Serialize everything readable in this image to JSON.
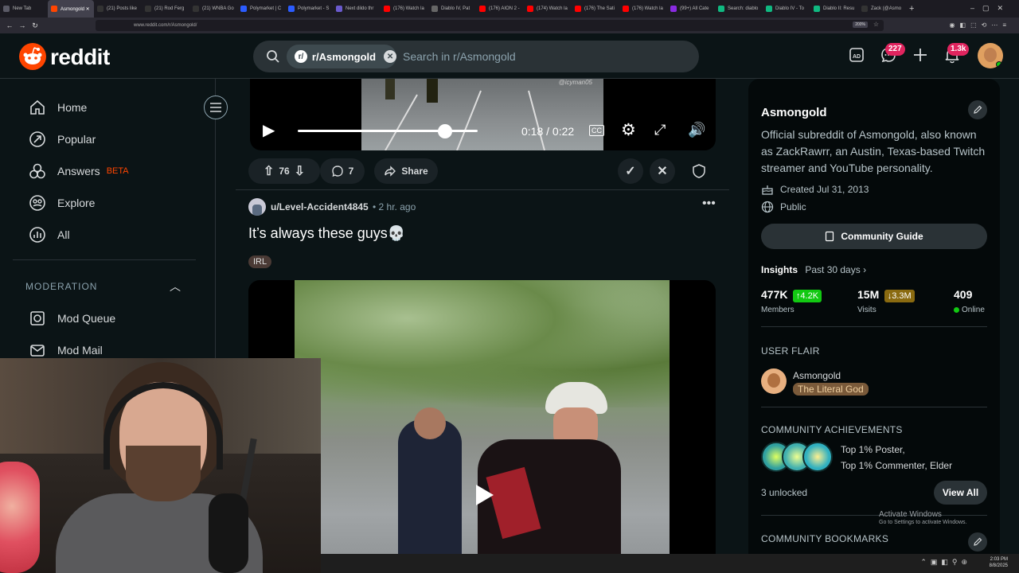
{
  "browser": {
    "tabs": [
      {
        "label": "New Tab",
        "color": "#5a5a66"
      },
      {
        "label": "Asmongold ✕",
        "color": "#ff4500"
      },
      {
        "label": "(21) Posts like",
        "color": "#333"
      },
      {
        "label": "(21) Rod Ferg",
        "color": "#333"
      },
      {
        "label": "(21) WNBA Go",
        "color": "#333"
      },
      {
        "label": "Polymarket | C",
        "color": "#2b5cff"
      },
      {
        "label": "Polymarket - S",
        "color": "#2b5cff"
      },
      {
        "label": "Next dildo thr",
        "color": "#6a5acd"
      },
      {
        "label": "(176) Watch la",
        "color": "#ff0000"
      },
      {
        "label": "Diablo IV, Pat",
        "color": "#666"
      },
      {
        "label": "(176) AION 2 -",
        "color": "#ff0000"
      },
      {
        "label": "(174) Watch la",
        "color": "#ff0000"
      },
      {
        "label": "(176) The Sati",
        "color": "#ff0000"
      },
      {
        "label": "(176) Watch la",
        "color": "#ff0000"
      },
      {
        "label": "(99+) All Cate",
        "color": "#8a2be2"
      },
      {
        "label": "Search: diablo",
        "color": "#10b981"
      },
      {
        "label": "Diablo IV - To",
        "color": "#10b981"
      },
      {
        "label": "Diablo II: Resu",
        "color": "#10b981"
      },
      {
        "label": "Zack (@Asmo",
        "color": "#333"
      }
    ],
    "url": "www.reddit.com/r/Asmongold/",
    "zoom": "200%"
  },
  "header": {
    "logo_text": "reddit",
    "search_chip": "r/Asmongold",
    "search_placeholder": "Search in r/Asmongold",
    "chat_badge": "227",
    "notif_badge": "1.3k"
  },
  "sidebar": {
    "items": [
      {
        "label": "Home"
      },
      {
        "label": "Popular"
      },
      {
        "label": "Answers",
        "tag": "BETA"
      },
      {
        "label": "Explore"
      },
      {
        "label": "All"
      }
    ],
    "moderation_heading": "MODERATION",
    "mod_items": [
      {
        "label": "Mod Queue"
      },
      {
        "label": "Mod Mail"
      }
    ]
  },
  "video_player": {
    "time": "0:18 / 0:22",
    "watermark": "@icyman05",
    "progress": 0.82
  },
  "post_actions": {
    "votes": "76",
    "comments": "7",
    "share": "Share"
  },
  "post": {
    "author": "u/Level-Accident4845",
    "time": "• 2 hr. ago",
    "title": "It’s always these guys💀",
    "flair": "IRL"
  },
  "community": {
    "name": "Asmongold",
    "description": "Official subreddit of Asmongold, also known as ZackRawrr, an Austin, Texas-based Twitch streamer and YouTube personality.",
    "created": "Created Jul 31, 2013",
    "visibility": "Public",
    "guide_button": "Community Guide",
    "insights_label": "Insights",
    "insights_period": "Past 30 days",
    "stats": [
      {
        "value": "477K",
        "delta": "↑4.2K",
        "label": "Members",
        "delta_color": "#12c912"
      },
      {
        "value": "15M",
        "delta": "↓3.3M",
        "label": "Visits",
        "delta_color": "#b8860b"
      },
      {
        "value": "409",
        "delta": "",
        "label": "Online",
        "delta_color": ""
      }
    ],
    "user_flair_heading": "USER FLAIR",
    "flair_user": "Asmongold",
    "flair_text": "The Literal God",
    "achievements_heading": "COMMUNITY ACHIEVEMENTS",
    "achievements_line1": "Top 1% Poster,",
    "achievements_line2": "Top 1% Commenter, Elder",
    "unlocked": "3 unlocked",
    "view_all": "View All",
    "bookmarks_heading": "COMMUNITY BOOKMARKS"
  },
  "windows_watermark": {
    "line1": "Activate Windows",
    "line2": "Go to Settings to activate Windows."
  },
  "taskbar": {
    "time": "2:03 PM",
    "date": "8/8/2025"
  }
}
